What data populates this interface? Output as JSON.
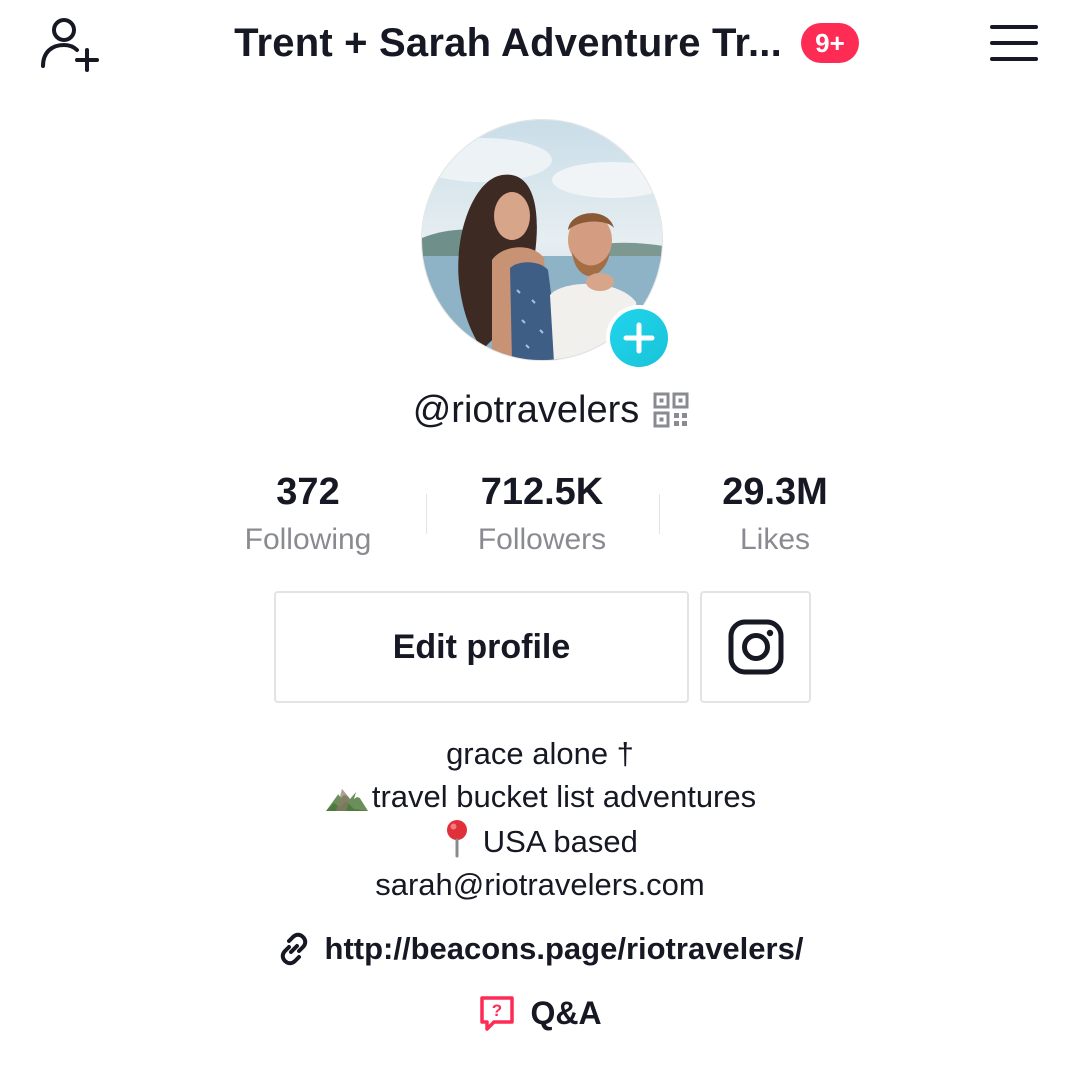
{
  "header": {
    "add_user_icon": "person-add-icon",
    "title": "Trent + Sarah Adventure Tr...",
    "notification_badge": "9+",
    "menu_icon": "hamburger-menu-icon",
    "badge_color": "#fe2c55"
  },
  "profile": {
    "avatar_description_icon": "avatar-photo",
    "add_avatar_icon": "plus-icon",
    "username": "@riotravelers",
    "qr_icon": "qr-code-icon",
    "accent_color": "#20d5ec"
  },
  "stats": [
    {
      "value": "372",
      "label": "Following"
    },
    {
      "value": "712.5K",
      "label": "Followers"
    },
    {
      "value": "29.3M",
      "label": "Likes"
    }
  ],
  "actions": {
    "edit_profile_label": "Edit profile",
    "instagram_icon": "instagram-icon"
  },
  "bio": {
    "line1": "grace alone †",
    "line2_emoji": "🏔️",
    "line2": "travel bucket list adventures",
    "line3_emoji": "📍",
    "line3": " USA based",
    "line4": "sarah@riotravelers.com"
  },
  "link": {
    "icon": "link-icon",
    "url": "http://beacons.page/riotravelers/"
  },
  "qa": {
    "icon": "question-bubble-icon",
    "label": "Q&A",
    "icon_color": "#fe2c55"
  }
}
